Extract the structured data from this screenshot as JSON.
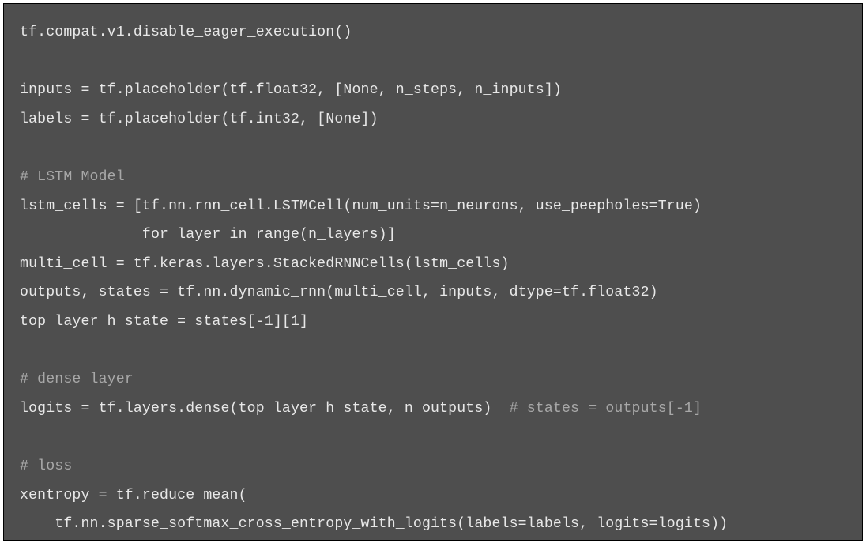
{
  "code": {
    "l1": "tf.compat.v1.disable_eager_execution()",
    "l2": "",
    "l3": "inputs = tf.placeholder(tf.float32, [None, n_steps, n_inputs])",
    "l4": "labels = tf.placeholder(tf.int32, [None])",
    "l5": "",
    "l6": "# LSTM Model",
    "l7": "lstm_cells = [tf.nn.rnn_cell.LSTMCell(num_units=n_neurons, use_peepholes=True)",
    "l8": "              for layer in range(n_layers)]",
    "l9": "multi_cell = tf.keras.layers.StackedRNNCells(lstm_cells)",
    "l10": "outputs, states = tf.nn.dynamic_rnn(multi_cell, inputs, dtype=tf.float32)",
    "l11": "top_layer_h_state = states[-1][1]",
    "l12": "",
    "l13": "# dense layer",
    "l14a": "logits = tf.layers.dense(top_layer_h_state, n_outputs)  ",
    "l14b": "# states = outputs[-1]",
    "l15": "",
    "l16": "# loss",
    "l17": "xentropy = tf.reduce_mean(",
    "l18": "    tf.nn.sparse_softmax_cross_entropy_with_logits(labels=labels, logits=logits))"
  }
}
